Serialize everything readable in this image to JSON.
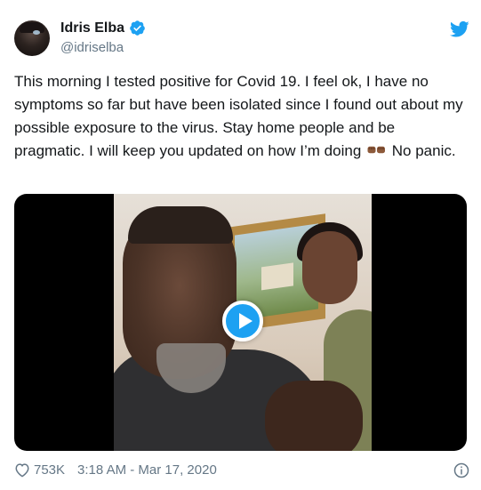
{
  "author": {
    "display_name": "Idris Elba",
    "handle": "@idriselba",
    "verified": true
  },
  "tweet": {
    "text_before_emoji": "This morning I tested positive for Covid 19. I feel ok, I have no symptoms so far but have been isolated since I found out about my possible exposure to the virus.  Stay home people and be pragmatic. I will keep you updated on how I’m doing",
    "emoji": "fist-bump-medium-dark-skin",
    "text_after_emoji": "No panic."
  },
  "media": {
    "type": "video",
    "play_icon": "play-icon"
  },
  "footer": {
    "likes": "753K",
    "timestamp": "3:18 AM - Mar 17, 2020"
  },
  "icons": {
    "brand": "twitter-bird-icon",
    "verified": "verified-badge-icon",
    "like": "heart-icon",
    "info": "info-icon"
  },
  "colors": {
    "brand": "#1da1f2",
    "text": "#14171a",
    "secondary_text": "#657786"
  }
}
